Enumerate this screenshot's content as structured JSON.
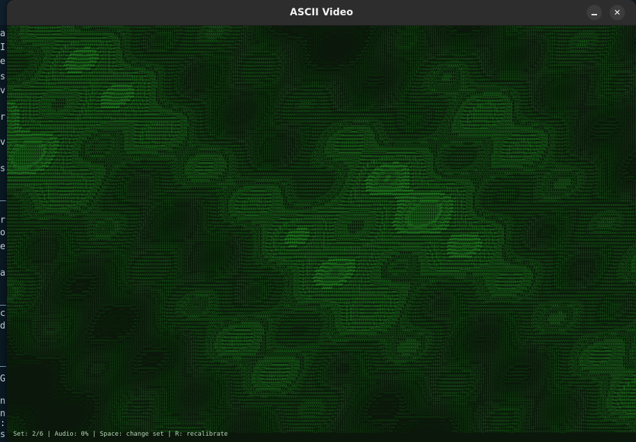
{
  "window": {
    "title": "ASCII Video",
    "minimize_icon": "minimize-icon",
    "close_icon": "close-icon"
  },
  "status_bar": {
    "text": "Set: 2/6 | Audio: 0% | Space: change set | R: recalibrate"
  },
  "background_strip": {
    "letters": [
      "a",
      "I",
      "e",
      "s",
      "v",
      "r",
      "v",
      "s",
      "r",
      "o",
      "e",
      "a",
      "c",
      "d",
      "G",
      "n",
      "n",
      ":",
      "s"
    ]
  },
  "ascii_frame": {
    "charset": " .',:;-~_=+*/|\\(){}[]!1ilIjtfrxnuvczXYUJCLQ0OZmwqpdbkhao#MW&8%B@$",
    "foreground": "#3fbf3f",
    "background": "#0a170a"
  }
}
